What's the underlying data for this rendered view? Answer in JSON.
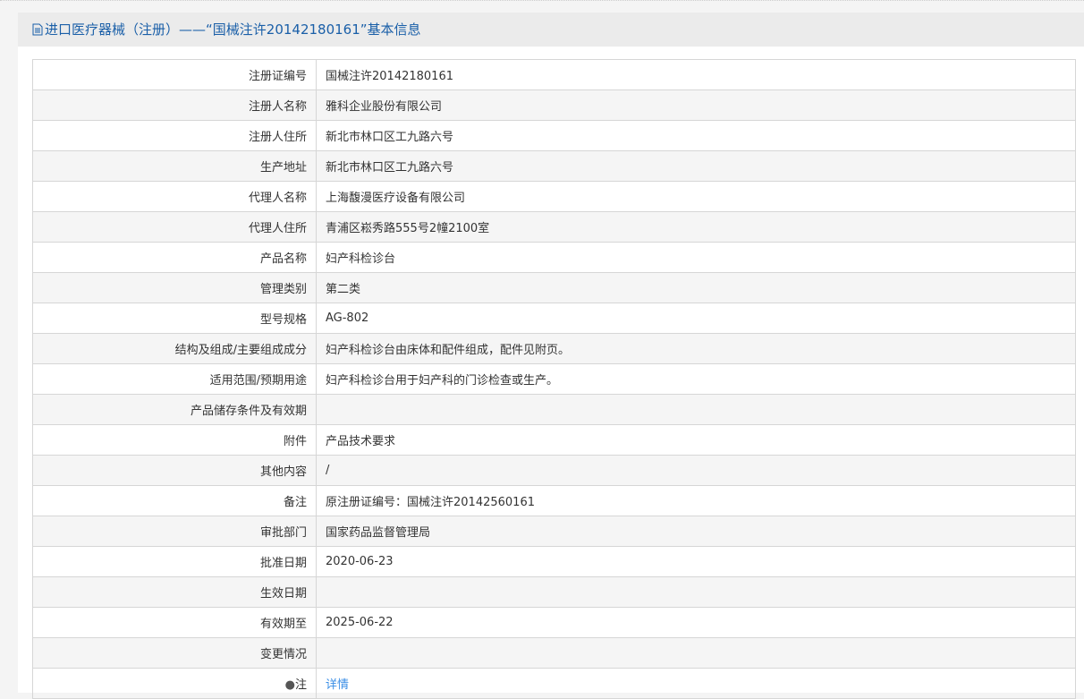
{
  "header": {
    "title": "进口医疗器械（注册）——“国械注许20142180161”基本信息"
  },
  "rows": [
    {
      "label": "注册证编号",
      "value": "国械注许20142180161"
    },
    {
      "label": "注册人名称",
      "value": "雅科企业股份有限公司"
    },
    {
      "label": "注册人住所",
      "value": "新北市林口区工九路六号"
    },
    {
      "label": "生产地址",
      "value": "新北市林口区工九路六号"
    },
    {
      "label": "代理人名称",
      "value": "上海馥漫医疗设备有限公司"
    },
    {
      "label": "代理人住所",
      "value": "青浦区崧秀路555号2幢2100室"
    },
    {
      "label": "产品名称",
      "value": "妇产科检诊台"
    },
    {
      "label": "管理类别",
      "value": "第二类"
    },
    {
      "label": "型号规格",
      "value": "AG-802"
    },
    {
      "label": "结构及组成/主要组成成分",
      "value": "妇产科检诊台由床体和配件组成，配件见附页。"
    },
    {
      "label": "适用范围/预期用途",
      "value": "妇产科检诊台用于妇产科的门诊检查或生产。"
    },
    {
      "label": "产品储存条件及有效期",
      "value": ""
    },
    {
      "label": "附件",
      "value": "产品技术要求"
    },
    {
      "label": "其他内容",
      "value": "/"
    },
    {
      "label": "备注",
      "value": "原注册证编号：国械注许20142560161"
    },
    {
      "label": "审批部门",
      "value": "国家药品监督管理局"
    },
    {
      "label": "批准日期",
      "value": "2020-06-23"
    },
    {
      "label": "生效日期",
      "value": ""
    },
    {
      "label": "有效期至",
      "value": "2025-06-22"
    },
    {
      "label": "变更情况",
      "value": ""
    }
  ],
  "note": {
    "label": "注",
    "link": "详情"
  }
}
